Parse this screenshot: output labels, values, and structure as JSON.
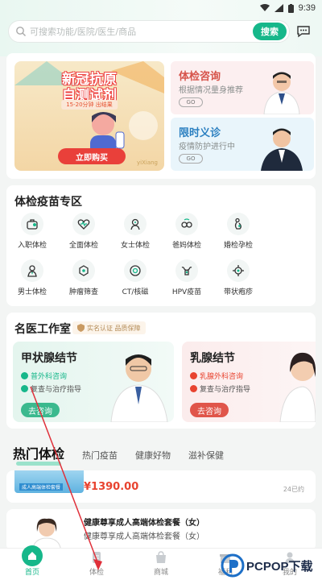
{
  "status_bar": {
    "time": "9:39"
  },
  "search": {
    "placeholder": "可搜索功能/医院/医生/商品",
    "button": "搜索"
  },
  "banner": {
    "promo": {
      "title_line1": "新冠抗原",
      "title_line2": "自测试剂",
      "subtitle": "15-20分钟 出结果",
      "button": "立即购买",
      "corner": "yiXiang"
    },
    "cards": [
      {
        "title": "体检咨询",
        "subtitle": "根据情况量身推荐",
        "go": "GO"
      },
      {
        "title": "限时义诊",
        "subtitle": "疫情防护进行中",
        "go": "GO"
      }
    ]
  },
  "zone": {
    "title": "体检疫苗专区",
    "items": [
      {
        "label": "入职体检",
        "icon": "briefcase-icon"
      },
      {
        "label": "全面体检",
        "icon": "heart-pulse-icon"
      },
      {
        "label": "女士体检",
        "icon": "woman-icon"
      },
      {
        "label": "爸妈体检",
        "icon": "glasses-icon"
      },
      {
        "label": "婚检孕检",
        "icon": "pregnancy-icon"
      },
      {
        "label": "男士体检",
        "icon": "man-icon"
      },
      {
        "label": "肿瘤筛查",
        "icon": "cell-icon"
      },
      {
        "label": "CT/核磁",
        "icon": "ct-scan-icon"
      },
      {
        "label": "HPV疫苗",
        "icon": "uterus-icon"
      },
      {
        "label": "带状疱疹",
        "icon": "virus-icon"
      }
    ]
  },
  "studio": {
    "title": "名医工作室",
    "badge": "实名认证 品质保障",
    "cards": [
      {
        "title": "甲状腺结节",
        "line1": "普外科咨询",
        "line2": "复查与治疗指导",
        "button": "去咨询"
      },
      {
        "title": "乳腺结节",
        "line1": "乳腺外科咨询",
        "line2": "复查与治疗指导",
        "button": "去咨询"
      }
    ]
  },
  "hot": {
    "tabs": [
      "热门体检",
      "热门疫苗",
      "健康好物",
      "滋补保健"
    ],
    "item1": {
      "image_text": "成人高端体检套餐",
      "price": "¥1390.00",
      "sold": "24已约"
    },
    "item2": {
      "title": "健康尊享成人高端体检套餐（女）",
      "subtitle": "健康尊享成人高端体检套餐（女）"
    }
  },
  "nav": [
    {
      "label": "首页",
      "icon": "home-icon"
    },
    {
      "label": "体检",
      "icon": "checkup-icon"
    },
    {
      "label": "商城",
      "icon": "bag-icon"
    },
    {
      "label": "福利",
      "icon": "gift-icon"
    },
    {
      "label": "我的",
      "icon": "user-icon"
    }
  ],
  "watermark": {
    "text": "PCPOP下载"
  },
  "colors": {
    "accent": "#16b78a",
    "price": "#e8432f",
    "promo_red": "#e9403a"
  }
}
